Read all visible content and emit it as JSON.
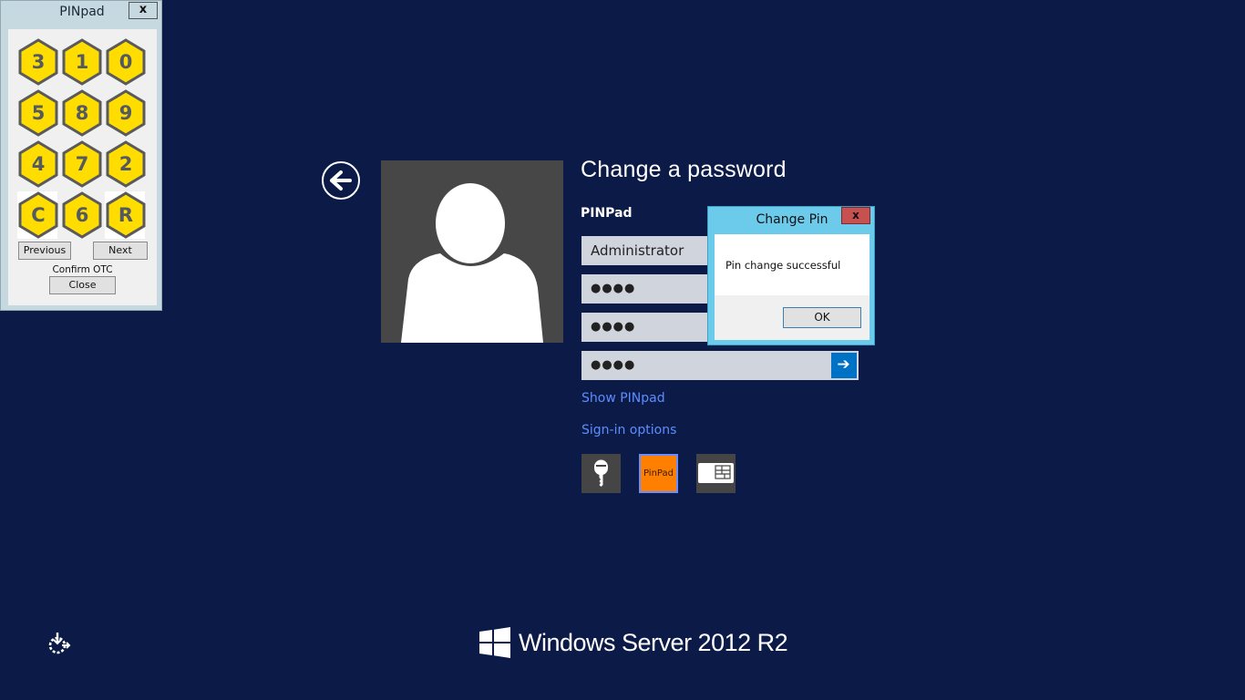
{
  "pinpad": {
    "title": "PINpad",
    "close_label": "x",
    "keys": [
      "3",
      "1",
      "0",
      "5",
      "8",
      "9",
      "4",
      "7",
      "2",
      "C",
      "6",
      "R"
    ],
    "previous_label": "Previous",
    "next_label": "Next",
    "confirm_label": "Confirm OTC",
    "close_button_label": "Close",
    "key_color": "#ffdd00",
    "key_border_color": "#5a5a5a"
  },
  "login": {
    "title": "Change a password",
    "provider": "PINPad",
    "username": "Administrator",
    "password_fields": [
      "●●●●",
      "●●●●",
      "●●●●"
    ],
    "submit_icon": "arrow-right-icon",
    "show_pinpad_link": "Show PINpad",
    "signin_options_link": "Sign-in options",
    "signin_options": [
      {
        "name": "password-key",
        "icon": "key-icon",
        "label": ""
      },
      {
        "name": "pinpad",
        "icon": "pinpad-icon",
        "label": "PinPad",
        "selected": true
      },
      {
        "name": "smart-card",
        "icon": "smart-card-icon",
        "label": ""
      }
    ],
    "accent_color": "#0072c6",
    "link_color": "#5d8dff"
  },
  "dialog": {
    "title": "Change Pin",
    "close_label": "x",
    "message": "Pin change successful",
    "ok_label": "OK"
  },
  "footer": {
    "brand": "Windows Server 2012 R2",
    "ease_of_access_icon": "ease-of-access-icon"
  },
  "background_color": "#0b1a47"
}
